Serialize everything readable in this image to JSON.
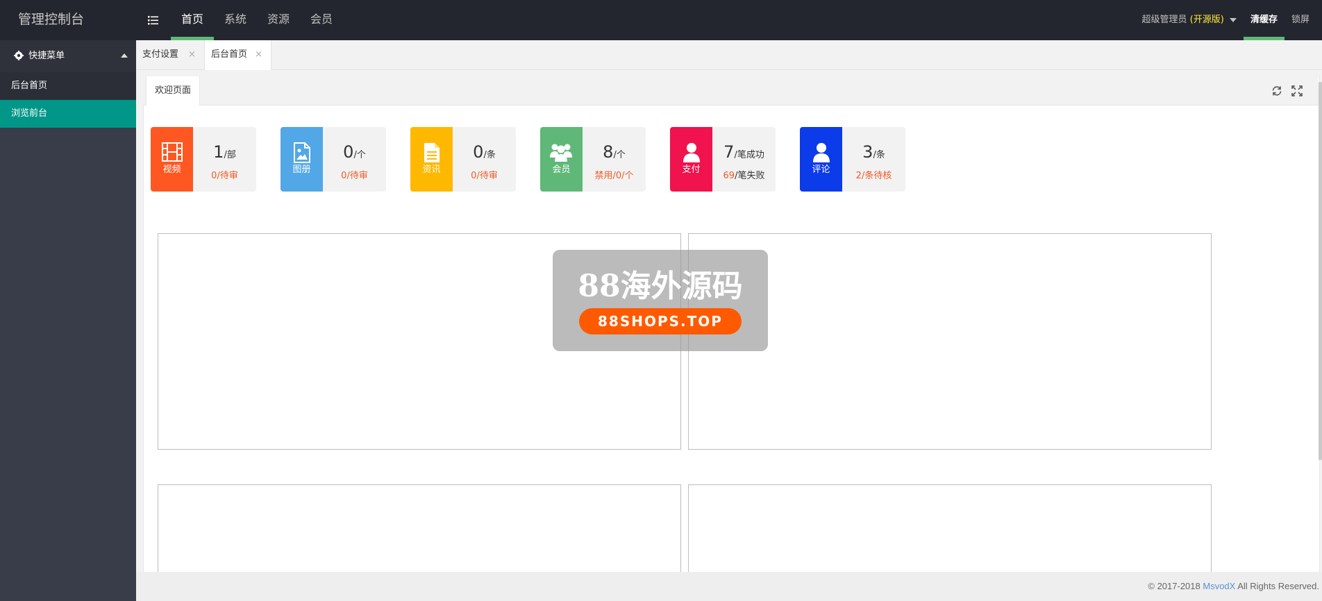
{
  "header": {
    "logo": "管理控制台",
    "nav": [
      {
        "label": "首页",
        "active": true
      },
      {
        "label": "系统",
        "active": false
      },
      {
        "label": "资源",
        "active": false
      },
      {
        "label": "会员",
        "active": false
      }
    ],
    "user_name": "超级管理员",
    "user_version": "(开源版)",
    "clear_cache": "清缓存",
    "lock_screen": "锁屏"
  },
  "sidebar": {
    "title": "快捷菜单",
    "items": [
      {
        "label": "后台首页",
        "active": false
      },
      {
        "label": "浏览前台",
        "active": true
      }
    ]
  },
  "tabs": [
    {
      "label": "支付设置",
      "close": "×"
    },
    {
      "label": "后台首页",
      "close": "×",
      "active": true
    }
  ],
  "subtab": "欢迎页面",
  "stats": [
    {
      "label": "视频",
      "count": "1",
      "unit": "/部",
      "sub_a": "0",
      "sub_b": "/待审",
      "color": "#ff5722"
    },
    {
      "label": "图册",
      "count": "0",
      "unit": "/个",
      "sub_a": "0",
      "sub_b": "/待审",
      "color": "#52a7e7"
    },
    {
      "label": "资讯",
      "count": "0",
      "unit": "/条",
      "sub_a": "0",
      "sub_b": "/待审",
      "color": "#ffb800"
    },
    {
      "label": "会员",
      "count": "8",
      "unit": "/个",
      "sub_a": "禁用",
      "sub_b": "/0/个",
      "color": "#5fb878"
    },
    {
      "label": "支付",
      "count": "7",
      "unit": "/笔成功",
      "sub_a": "69",
      "sub_b": "/笔失败",
      "color": "#f0134d"
    },
    {
      "label": "评论",
      "count": "3",
      "unit": "/条",
      "sub_a": "2",
      "sub_b": "/条待核",
      "color": "#0c3be9"
    }
  ],
  "watermark": {
    "title": "88海外源码",
    "url": "88SHOPS.TOP"
  },
  "footer": {
    "prefix": "© 2017-2018 ",
    "brand": "MsvodX",
    "suffix": " All Rights Reserved."
  },
  "icons": {
    "menu_toggle": "list-icon",
    "settings": "gear-icon",
    "refresh": "refresh-icon",
    "fullscreen": "fullscreen-icon"
  }
}
